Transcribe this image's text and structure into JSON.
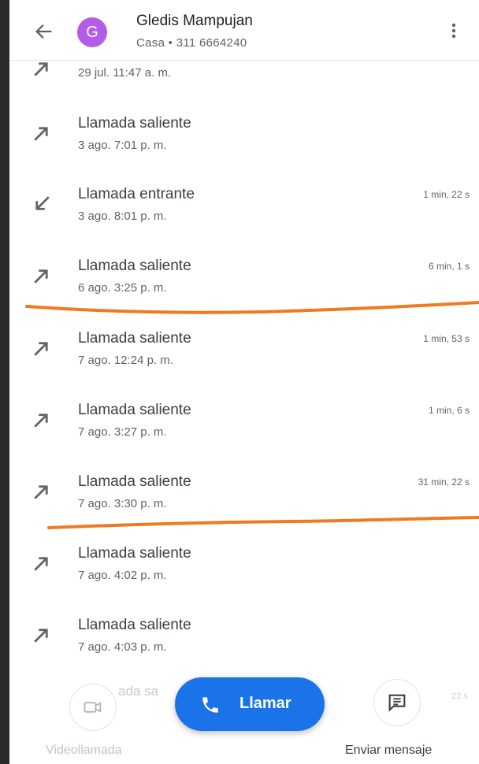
{
  "header": {
    "contact_initial": "G",
    "contact_name": "Gledis Mampujan",
    "contact_detail": "Casa • 311 6664240",
    "avatar_color": "#b35ce8"
  },
  "call_log": [
    {
      "type": "outgoing",
      "title": "",
      "time": "29 jul. 11:47 a. m.",
      "duration": ""
    },
    {
      "type": "outgoing",
      "title": "Llamada saliente",
      "time": "3 ago. 7:01 p. m.",
      "duration": ""
    },
    {
      "type": "incoming",
      "title": "Llamada entrante",
      "time": "3 ago. 8:01 p. m.",
      "duration": "1 min, 22 s"
    },
    {
      "type": "outgoing",
      "title": "Llamada saliente",
      "time": "6 ago. 3:25 p. m.",
      "duration": "6 min, 1 s"
    },
    {
      "type": "outgoing",
      "title": "Llamada saliente",
      "time": "7 ago. 12:24 p. m.",
      "duration": "1 min, 53 s"
    },
    {
      "type": "outgoing",
      "title": "Llamada saliente",
      "time": "7 ago. 3:27 p. m.",
      "duration": "1 min, 6 s"
    },
    {
      "type": "outgoing",
      "title": "Llamada saliente",
      "time": "7 ago. 3:30 p. m.",
      "duration": "31 min, 22 s"
    },
    {
      "type": "outgoing",
      "title": "Llamada saliente",
      "time": "7 ago. 4:02 p. m.",
      "duration": ""
    },
    {
      "type": "outgoing",
      "title": "Llamada saliente",
      "time": "7 ago. 4:03 p. m.",
      "duration": ""
    }
  ],
  "bottom_bar": {
    "video_label": "Videollamada",
    "call_label": "Llamar",
    "message_label": "Enviar mensaje",
    "faded_row_text": "ada sa",
    "faded_row_duration": "22 s",
    "call_button_color": "#1a73e8"
  },
  "annotations": {
    "marker_color": "#f07a1f"
  }
}
